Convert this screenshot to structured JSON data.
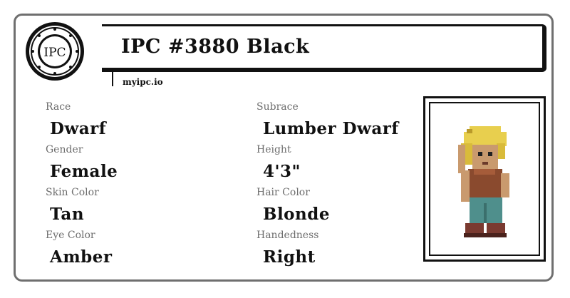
{
  "header": {
    "seal_text": "IPC",
    "title": "IPC #3880 Black",
    "url": "myipc.io"
  },
  "attributes": [
    {
      "label": "Race",
      "value": "Dwarf"
    },
    {
      "label": "Subrace",
      "value": "Lumber Dwarf"
    },
    {
      "label": "Gender",
      "value": "Female"
    },
    {
      "label": "Height",
      "value": "4'3\""
    },
    {
      "label": "Skin Color",
      "value": "Tan"
    },
    {
      "label": "Hair Color",
      "value": "Blonde"
    },
    {
      "label": "Eye Color",
      "value": "Amber"
    },
    {
      "label": "Handedness",
      "value": "Right"
    }
  ],
  "colors": {
    "border": "#6f6f6f",
    "text": "#111111",
    "label": "#6d6d6d",
    "hair": "#e8cf4e",
    "skin": "#c99a6e",
    "shirt": "#8a4a2e",
    "pants": "#4f8f8c",
    "boots": "#7a3a30"
  }
}
